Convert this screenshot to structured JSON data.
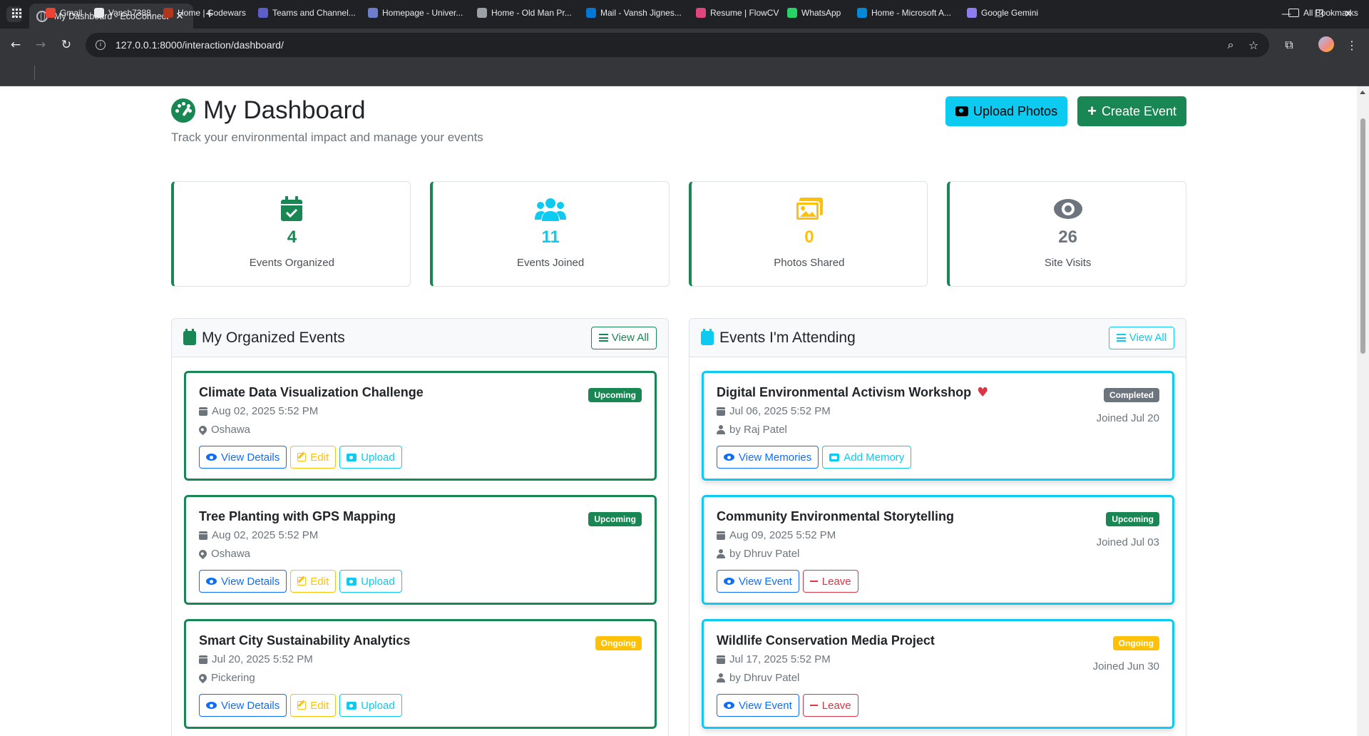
{
  "browser": {
    "tab_title": "My Dashboard - EcoConnect",
    "url": "127.0.0.1:8000/interaction/dashboard/",
    "bookmarks": [
      {
        "label": "Gmail",
        "color": "#ea4335"
      },
      {
        "label": "Vansh7388",
        "color": "#e8eaed"
      },
      {
        "label": "Home | Codewars",
        "color": "#b1361e"
      },
      {
        "label": "Teams and Channel...",
        "color": "#5b5fc7"
      },
      {
        "label": "Homepage - Univer...",
        "color": "#6d7fcc"
      },
      {
        "label": "Home - Old Man Pr...",
        "color": "#9aa0a6"
      },
      {
        "label": "Mail - Vansh Jignes...",
        "color": "#0078d4"
      },
      {
        "label": "Resume | FlowCV",
        "color": "#e0457b"
      },
      {
        "label": "WhatsApp",
        "color": "#25d366"
      },
      {
        "label": "Home - Microsoft A...",
        "color": "#0089d6"
      },
      {
        "label": "Google Gemini",
        "color": "#8e7cf0"
      }
    ],
    "all_bookmarks": "All Bookmarks"
  },
  "page": {
    "title": "My Dashboard",
    "subtitle": "Track your environmental impact and manage your events",
    "upload_photos": "Upload Photos",
    "create_event": "Create Event"
  },
  "stats": [
    {
      "value": "4",
      "label": "Events Organized",
      "color": "#198754",
      "icon": "calendar-check-icon"
    },
    {
      "value": "11",
      "label": "Events Joined",
      "color": "#0dcaf0",
      "icon": "users-icon"
    },
    {
      "value": "0",
      "label": "Photos Shared",
      "color": "#ffc107",
      "icon": "images-icon"
    },
    {
      "value": "26",
      "label": "Site Visits",
      "color": "#6c757d",
      "icon": "eye-icon"
    }
  ],
  "organized": {
    "heading": "My Organized Events",
    "view_all": "View All",
    "events": [
      {
        "title": "Climate Data Visualization Challenge",
        "date": "Aug 02, 2025 5:52 PM",
        "location": "Oshawa",
        "status": "Upcoming"
      },
      {
        "title": "Tree Planting with GPS Mapping",
        "date": "Aug 02, 2025 5:52 PM",
        "location": "Oshawa",
        "status": "Upcoming"
      },
      {
        "title": "Smart City Sustainability Analytics",
        "date": "Jul 20, 2025 5:52 PM",
        "location": "Pickering",
        "status": "Ongoing"
      }
    ],
    "btn_view": "View Details",
    "btn_edit": "Edit",
    "btn_upload": "Upload"
  },
  "attending": {
    "heading": "Events I'm Attending",
    "view_all": "View All",
    "events": [
      {
        "title": "Digital Environmental Activism Workshop",
        "date": "Jul 06, 2025 5:52 PM",
        "organizer": "by Raj Patel",
        "status": "Completed",
        "joined": "Joined Jul 20",
        "btn1": "View Memories",
        "btn2": "Add Memory"
      },
      {
        "title": "Community Environmental Storytelling",
        "date": "Aug 09, 2025 5:52 PM",
        "organizer": "by Dhruv Patel",
        "status": "Upcoming",
        "joined": "Joined Jul 03",
        "btn1": "View Event",
        "btn2": "Leave"
      },
      {
        "title": "Wildlife Conservation Media Project",
        "date": "Jul 17, 2025 5:52 PM",
        "organizer": "by Dhruv Patel",
        "status": "Ongoing",
        "joined": "Joined Jun 30",
        "btn1": "View Event",
        "btn2": "Leave"
      }
    ]
  }
}
